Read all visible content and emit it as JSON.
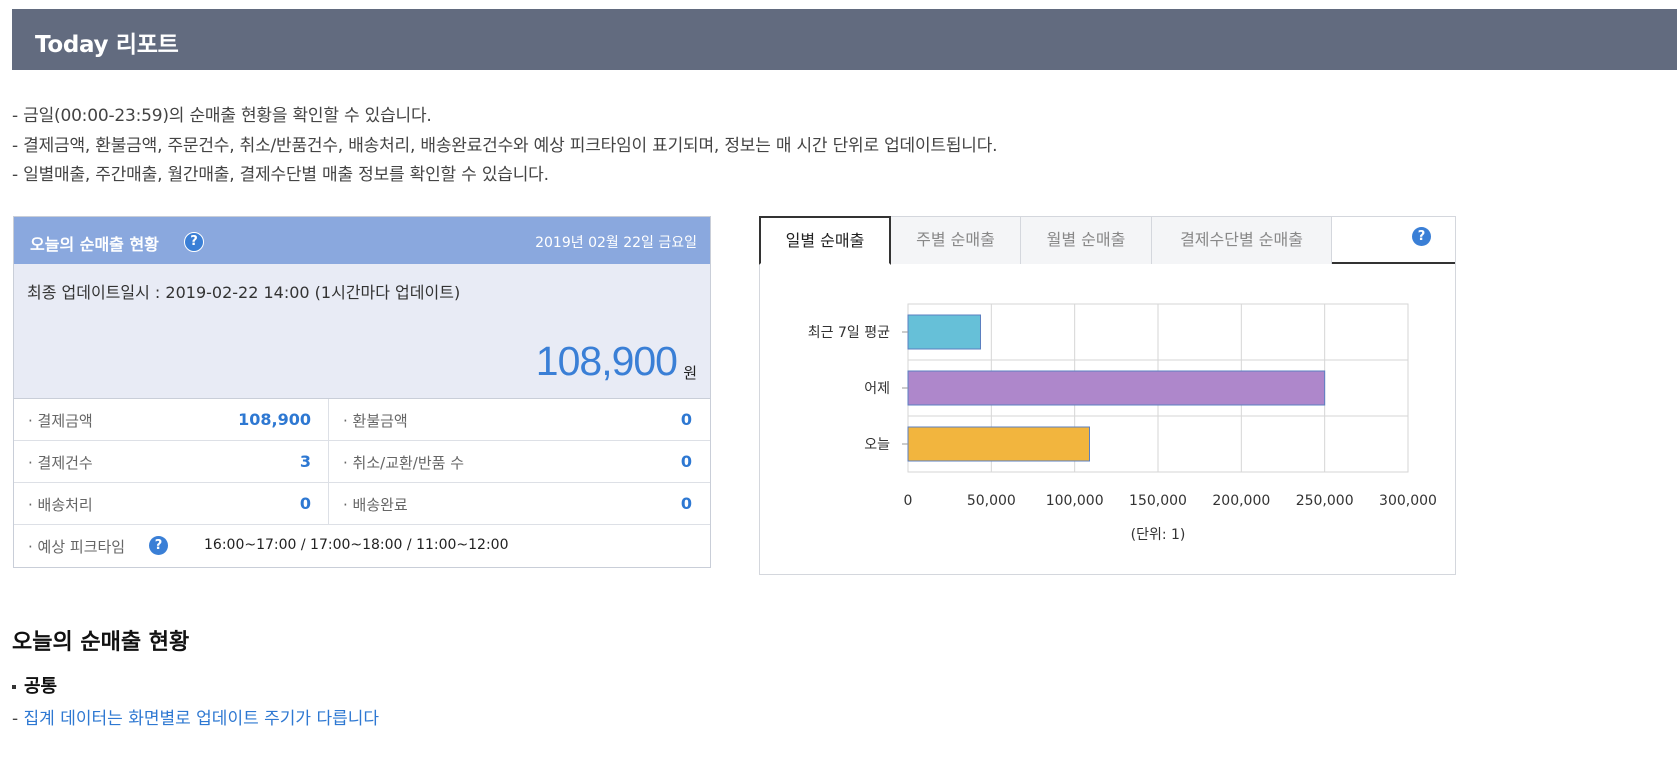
{
  "header": {
    "title": "Today 리포트"
  },
  "descriptions": [
    "- 금일(00:00-23:59)의 순매출 현황을 확인할 수 있습니다.",
    "- 결제금액, 환불금액, 주문건수, 취소/반품건수, 배송처리, 배송완료건수와 예상 피크타임이 표기되며, 정보는 매 시간 단위로 업데이트됩니다.",
    "- 일별매출, 주간매출, 월간매출, 결제수단별 매출 정보를 확인할 수 있습니다."
  ],
  "summary_panel": {
    "title": "오늘의 순매출 현황",
    "help": "?",
    "date": "2019년 02월 22일 금요일",
    "update_text": "최종 업데이트일시 : 2019-02-22 14:00 (1시간마다 업데이트)",
    "total_amount": "108,900",
    "currency": "원",
    "rows": [
      {
        "left_label": "· 결제금액",
        "left_value": "108,900",
        "right_label": "· 환불금액",
        "right_value": "0"
      },
      {
        "left_label": "· 결제건수",
        "left_value": "3",
        "right_label": "· 취소/교환/반품 수",
        "right_value": "0"
      },
      {
        "left_label": "· 배송처리",
        "left_value": "0",
        "right_label": "· 배송완료",
        "right_value": "0"
      }
    ],
    "peak_label": "· 예상 피크타임",
    "peak_value": "16:00~17:00 / 17:00~18:00 / 11:00~12:00"
  },
  "chart_panel": {
    "tabs": [
      "일별 순매출",
      "주별 순매출",
      "월별 순매출",
      "결제수단별 순매출"
    ],
    "active_tab": 0,
    "help": "?"
  },
  "chart_data": {
    "type": "bar",
    "orientation": "horizontal",
    "categories": [
      "최근 7일 평균",
      "어제",
      "오늘"
    ],
    "values": [
      43500,
      250000,
      108900
    ],
    "colors": [
      "#66c0d8",
      "#ae87cb",
      "#f2b53e"
    ],
    "xticks": [
      "0",
      "50,000",
      "100,000",
      "150,000",
      "200,000",
      "250,000",
      "300,000"
    ],
    "xlim": [
      0,
      300000
    ],
    "xlabel": "(단위: 1)",
    "grid": true
  },
  "bottom": {
    "section_title": "오늘의 순매출 현황",
    "sub_title": "공통",
    "note_dash": "- ",
    "note": "집계 데이터는 화면별로 업데이트 주기가 다릅니다"
  }
}
